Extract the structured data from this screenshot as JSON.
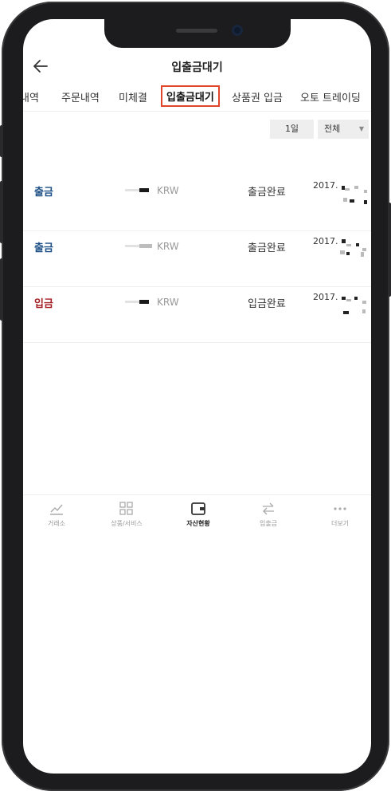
{
  "header": {
    "title": "입출금대기",
    "back_icon": "arrow-left-icon"
  },
  "tabs": [
    {
      "label": "내역"
    },
    {
      "label": "주문내역"
    },
    {
      "label": "미체결"
    },
    {
      "label": "입출금대기",
      "active": true
    },
    {
      "label": "상품권 입금"
    },
    {
      "label": "오토 트레이딩"
    }
  ],
  "filters": {
    "period": "1일",
    "type": "전체"
  },
  "transactions": [
    {
      "type": "출금",
      "kind": "withdraw",
      "currency": "KRW",
      "status": "출금완료",
      "date": "2017."
    },
    {
      "type": "출금",
      "kind": "withdraw",
      "currency": "KRW",
      "status": "출금완료",
      "date": "2017."
    },
    {
      "type": "입금",
      "kind": "deposit",
      "currency": "KRW",
      "status": "입금완료",
      "date": "2017."
    }
  ],
  "bottom_nav": [
    {
      "label": "거래소",
      "icon": "chart-trend-icon"
    },
    {
      "label": "상품/서비스",
      "icon": "grid-icon"
    },
    {
      "label": "자산현황",
      "icon": "wallet-icon",
      "active": true
    },
    {
      "label": "입출금",
      "icon": "transfer-arrows-icon"
    },
    {
      "label": "더보기",
      "icon": "more-dots-icon"
    }
  ],
  "colors": {
    "withdraw": "#1c4f86",
    "deposit": "#a31f24",
    "active_tab_border": "#e0442b"
  }
}
